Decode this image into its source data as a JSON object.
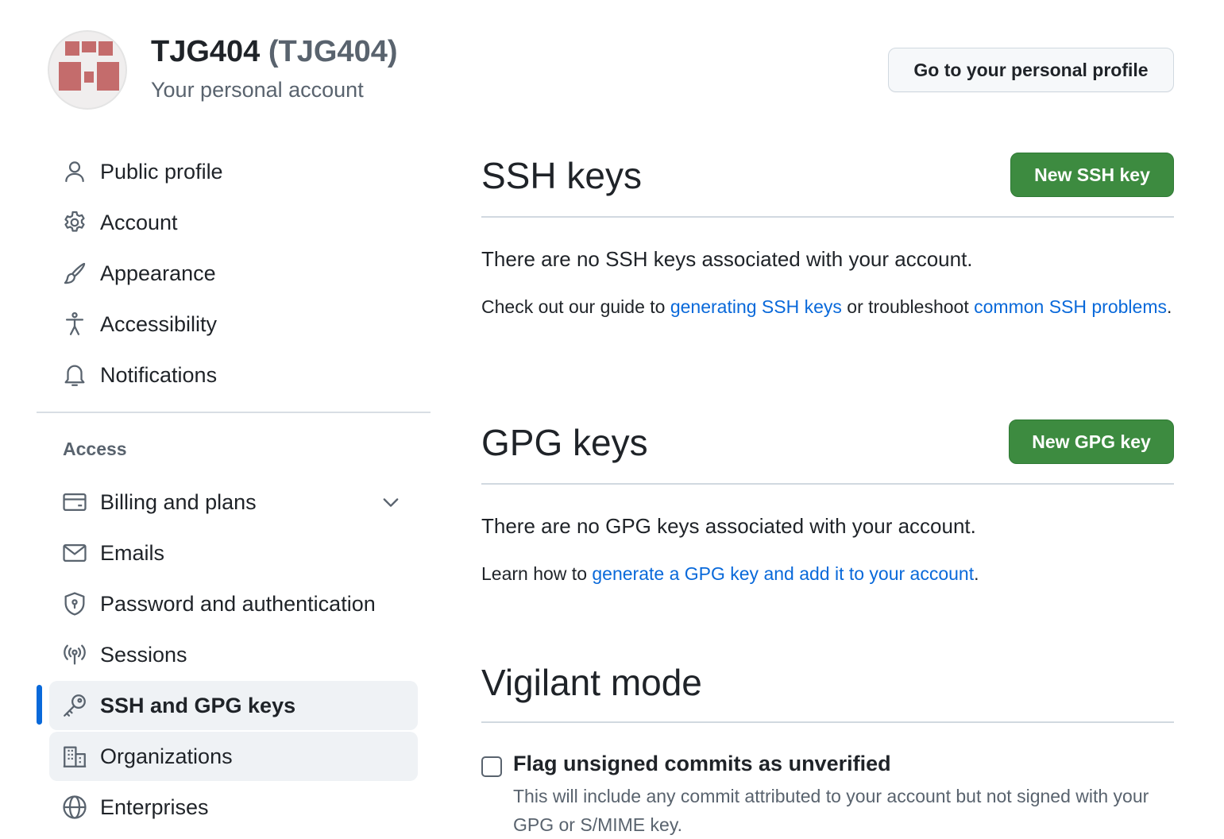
{
  "header": {
    "account_name": "TJG404",
    "account_login": "(TJG404)",
    "account_subtitle": "Your personal account",
    "profile_button": "Go to your personal profile"
  },
  "sidebar": {
    "items": [
      {
        "label": "Public profile",
        "icon": "person-icon"
      },
      {
        "label": "Account",
        "icon": "gear-icon"
      },
      {
        "label": "Appearance",
        "icon": "paintbrush-icon"
      },
      {
        "label": "Accessibility",
        "icon": "accessibility-icon"
      },
      {
        "label": "Notifications",
        "icon": "bell-icon"
      }
    ],
    "access_section": {
      "title": "Access",
      "items": [
        {
          "label": "Billing and plans",
          "icon": "credit-card-icon"
        },
        {
          "label": "Emails",
          "icon": "mail-icon"
        },
        {
          "label": "Password and authentication",
          "icon": "shield-lock-icon"
        },
        {
          "label": "Sessions",
          "icon": "broadcast-icon"
        },
        {
          "label": "SSH and GPG keys",
          "icon": "key-icon",
          "active": true
        },
        {
          "label": "Organizations",
          "icon": "organization-icon"
        },
        {
          "label": "Enterprises",
          "icon": "globe-icon"
        }
      ]
    }
  },
  "main": {
    "ssh": {
      "title": "SSH keys",
      "button": "New SSH key",
      "empty_message": "There are no SSH keys associated with your account.",
      "help_prefix": "Check out our guide to ",
      "help_link1": "generating SSH keys",
      "help_middle": " or troubleshoot ",
      "help_link2": "common SSH problems",
      "help_suffix": "."
    },
    "gpg": {
      "title": "GPG keys",
      "button": "New GPG key",
      "empty_message": "There are no GPG keys associated with your account.",
      "help_prefix": "Learn how to ",
      "help_link": "generate a GPG key and add it to your account",
      "help_suffix": "."
    },
    "vigilant": {
      "title": "Vigilant mode",
      "checkbox_label": "Flag unsigned commits as unverified",
      "checkbox_checked": false,
      "checkbox_description": "This will include any commit attributed to your account but not signed with your GPG or S/MIME key."
    }
  },
  "colors": {
    "accent": "#0969da",
    "primary_button": "#3d8b40",
    "avatar": "#c46c6c"
  }
}
